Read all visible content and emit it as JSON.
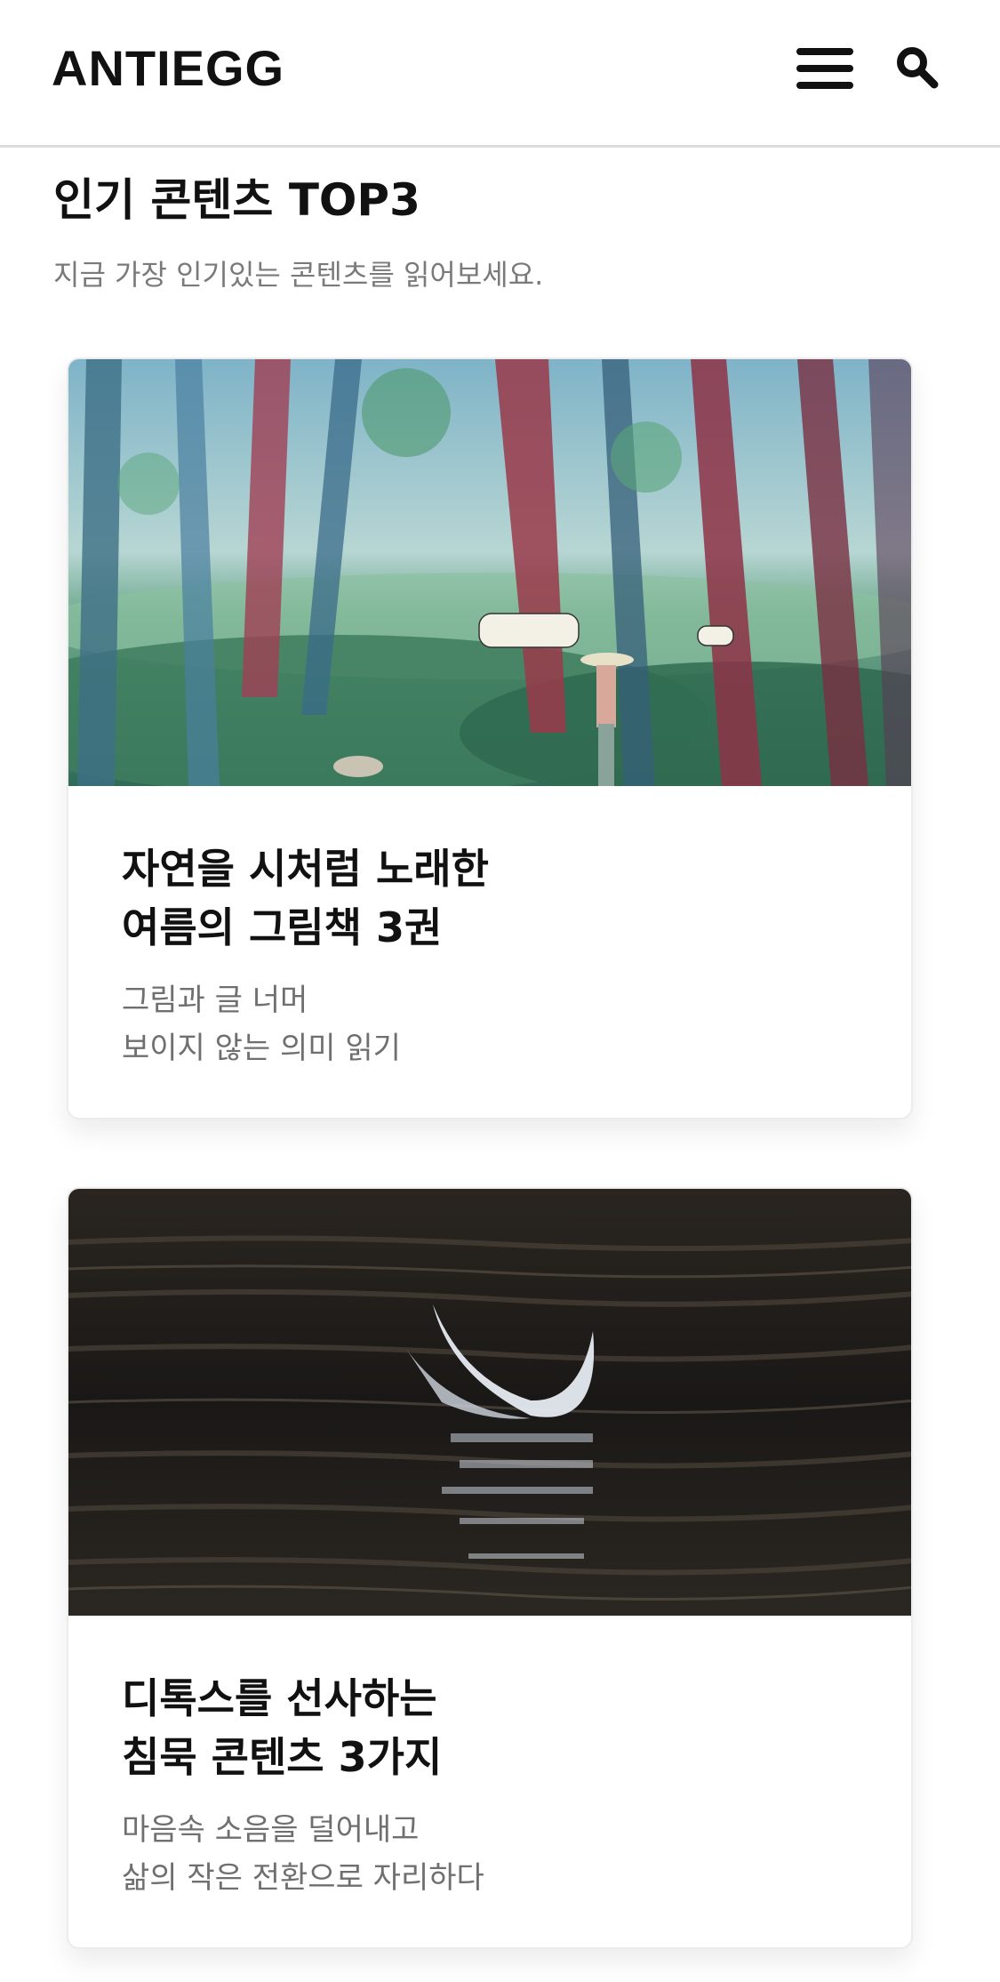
{
  "header": {
    "logo": "ANTIEGG",
    "menu_icon": "hamburger-menu-icon",
    "search_icon": "search-icon"
  },
  "section": {
    "title": "인기 콘텐츠 TOP3",
    "subtitle": "지금 가장 인기있는 콘텐츠를 읽어보세요."
  },
  "cards": [
    {
      "image": "forest-watercolor-illustration",
      "title_lines": [
        "자연을 시처럼 노래한",
        "여름의 그림책 3권"
      ],
      "desc_lines": [
        "그림과 글 너머",
        "보이지 않는 의미 읽기"
      ]
    },
    {
      "image": "feather-on-dark-water-photo",
      "title_lines": [
        "디톡스를 선사하는",
        "침묵 콘텐츠 3가지"
      ],
      "desc_lines": [
        "마음속 소음을 덜어내고",
        "삶의 작은 전환으로 자리하다"
      ]
    }
  ],
  "colors": {
    "text": "#111111",
    "muted": "#7a7a7a",
    "divider": "#dcdcdc"
  }
}
